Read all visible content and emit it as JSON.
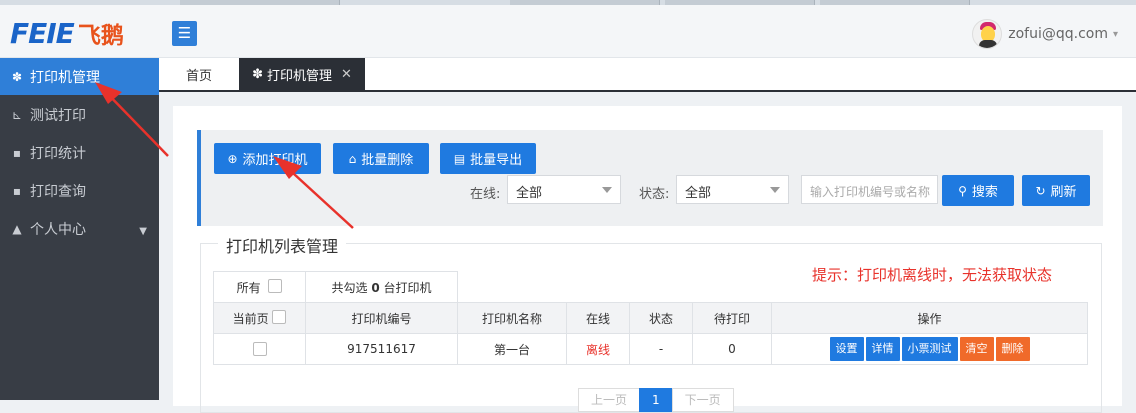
{
  "logo": {
    "en": "FEIE",
    "cn": "飞鹅"
  },
  "header": {
    "user_email": "zofui@qq.com",
    "caret": "▾",
    "menu_icon": "☰"
  },
  "sidebar": {
    "items": [
      {
        "label": "打印机管理",
        "icon": "cubes-icon",
        "glyph": "✽",
        "active": true
      },
      {
        "label": "测试打印",
        "icon": "chart-icon",
        "glyph": "⊾"
      },
      {
        "label": "打印统计",
        "icon": "comment-icon",
        "glyph": "▪"
      },
      {
        "label": "打印查询",
        "icon": "comment-icon",
        "glyph": "▪"
      },
      {
        "label": "个人中心",
        "icon": "user-icon",
        "glyph": "▲",
        "dropdown": "▼"
      }
    ]
  },
  "tabs": {
    "home": "首页",
    "current": "打印机管理",
    "current_icon": "✽",
    "close": "✕"
  },
  "toolbar": {
    "add": "添加打印机",
    "add_icon": "⊕",
    "batch_delete": "批量删除",
    "batch_delete_icon": "⌂",
    "batch_export": "批量导出",
    "batch_export_icon": "▤",
    "online_label": "在线:",
    "online_value": "全部",
    "status_label": "状态:",
    "status_value": "全部",
    "search_placeholder": "输入打印机编号或名称",
    "search": "搜索",
    "search_icon": "⚲",
    "refresh": "刷新",
    "refresh_icon": "↻"
  },
  "list": {
    "legend": "打印机列表管理",
    "hint": "提示：打印机离线时，无法获取状态",
    "all_label": "所有",
    "selected_text_prefix": "共勾选",
    "selected_count": "0",
    "selected_text_suffix": "台打印机",
    "current_page_label": "当前页",
    "columns": [
      "打印机编号",
      "打印机名称",
      "在线",
      "状态",
      "待打印",
      "操作"
    ],
    "rows": [
      {
        "id": "917511617",
        "name": "第一台",
        "online": "离线",
        "status": "-",
        "pending": "0"
      }
    ],
    "actions": [
      {
        "label": "设置",
        "color": "blue"
      },
      {
        "label": "详情",
        "color": "blue"
      },
      {
        "label": "小票测试",
        "color": "blue"
      },
      {
        "label": "清空",
        "color": "orange"
      },
      {
        "label": "删除",
        "color": "orange"
      }
    ]
  },
  "pager": {
    "prev": "上一页",
    "page": "1",
    "next": "下一页"
  },
  "colors": {
    "primary": "#1f7ae0",
    "sidebar": "#383d45",
    "danger": "#e8322b",
    "warning": "#f06a2a"
  }
}
